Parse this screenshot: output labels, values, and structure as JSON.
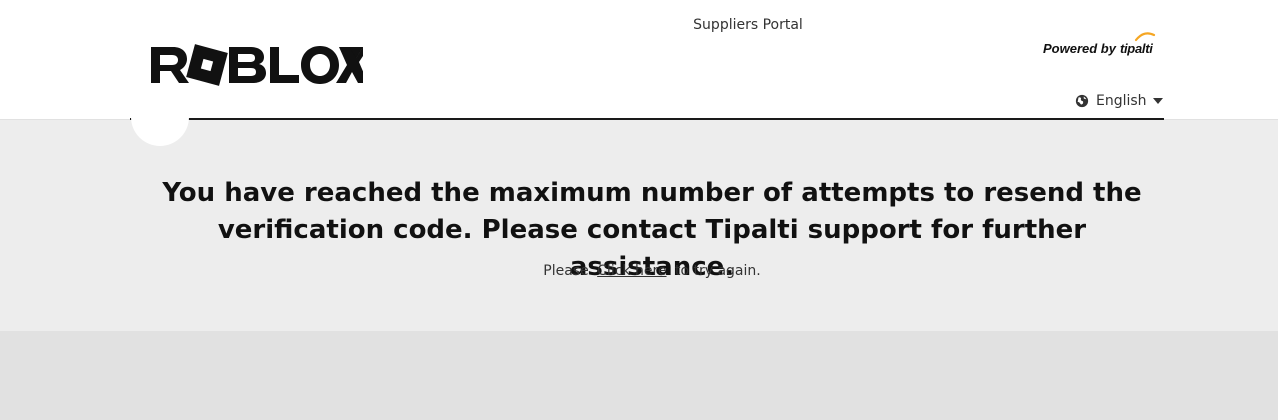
{
  "header": {
    "portal_title": "Suppliers Portal",
    "logo_text": "ROBLOX",
    "powered_by": "Powered by",
    "powered_brand": "tipalti",
    "language": {
      "label": "English",
      "icon": "globe-icon",
      "dropdown_icon": "caret-down-icon"
    }
  },
  "main": {
    "message": "You have reached the maximum number of attempts to resend the verification code. Please contact Tipalti support for further assistance.",
    "retry_prefix": "Please",
    "retry_link": "Click here",
    "retry_suffix": "to try again."
  },
  "colors": {
    "header_bg": "#ffffff",
    "panel_bg": "#ededed",
    "page_bg": "#e1e1e1",
    "text": "#111111",
    "brand_accent": "#f5a623"
  }
}
